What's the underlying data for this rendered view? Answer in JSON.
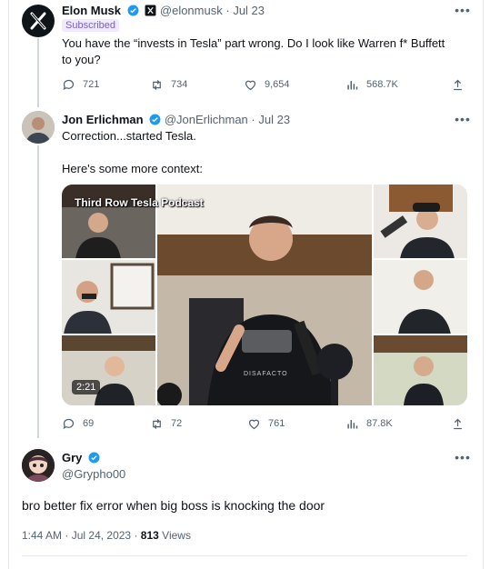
{
  "tweet1": {
    "name": "Elon Musk",
    "handle": "@elonmusk",
    "date": "Jul 23",
    "badge": "Subscribed",
    "text_line1": "You have the “invests in Tesla” part wrong. Do I look like Warren f* Buffett",
    "text_line2": "to you?",
    "stats": {
      "replies": "721",
      "retweets": "734",
      "likes": "9,654",
      "views": "568.7K"
    }
  },
  "tweet2": {
    "name": "Jon Erlichman",
    "handle": "@JonErlichman",
    "date": "Jul 23",
    "text_line1": "Correction...started Tesla.",
    "text_line2": "Here's some more context:",
    "video": {
      "overlay_title": "Third Row Tesla Podcast",
      "duration": "2:21",
      "shirt_text": "DISAFACTO"
    },
    "stats": {
      "replies": "69",
      "retweets": "72",
      "likes": "761",
      "views": "87.8K"
    }
  },
  "tweet3": {
    "name": "Gry",
    "handle": "@Grypho00",
    "text": "bro better fix error when big boss is knocking the door",
    "time": "1:44 AM",
    "date": "Jul 24, 2023",
    "views_count": "813",
    "views_label": "Views"
  },
  "icons": [
    "x-logo-icon",
    "verified-badge-icon",
    "more-options-icon",
    "reply-icon",
    "retweet-icon",
    "like-icon",
    "views-icon",
    "share-icon"
  ],
  "colors": {
    "verified": "#1d9bf0",
    "muted": "#536471",
    "text": "#0f1419",
    "subscribed": "#7a5ed0"
  }
}
